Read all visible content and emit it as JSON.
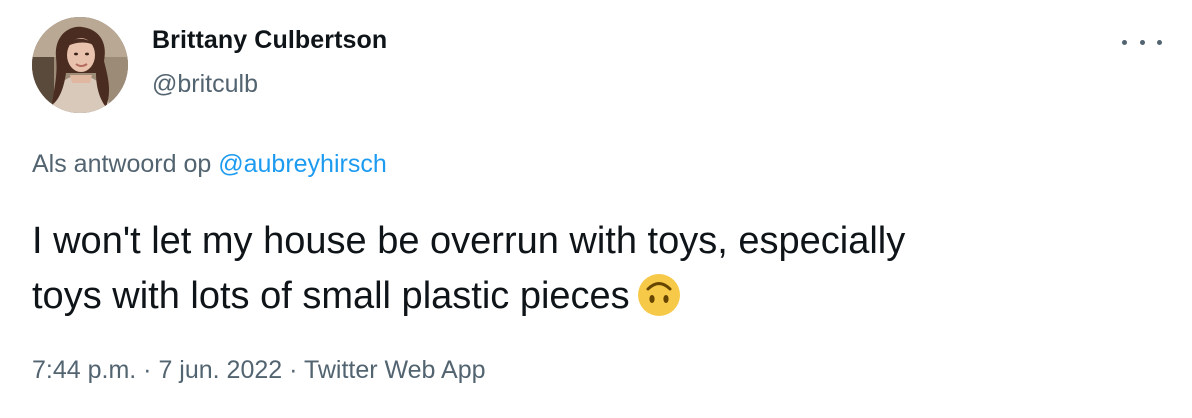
{
  "author": {
    "display_name": "Brittany Culbertson",
    "handle": "@britculb",
    "avatar_icon": "profile-photo"
  },
  "menu": {
    "icon": "more-options-icon"
  },
  "reply": {
    "prefix": "Als antwoord op",
    "mention": "@aubreyhirsch"
  },
  "tweet": {
    "line1": "I won't let my house be overrun with toys, especially",
    "line2": "toys with lots of small plastic pieces",
    "emoji": "upside-down-face-emoji"
  },
  "meta": {
    "time": "7:44 p.m.",
    "separator1": " · ",
    "date": "7 jun. 2022",
    "separator2": " · ",
    "source": "Twitter Web App"
  },
  "colors": {
    "text_primary": "#0f1419",
    "text_secondary": "#536471",
    "link": "#1d9bf0",
    "emoji_face": "#f7c948"
  }
}
